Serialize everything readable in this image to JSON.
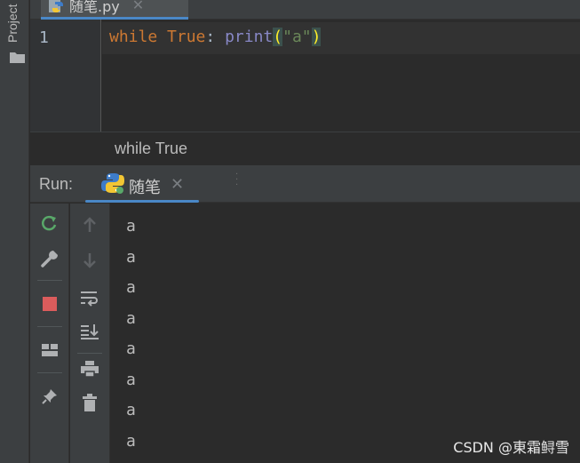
{
  "sidebar": {
    "project_label": "Project"
  },
  "editor": {
    "tab": {
      "filename": "随笔.py",
      "close": "✕"
    },
    "line_number": "1",
    "code": {
      "kw_while": "while",
      "kw_true": "True",
      "colon": ":",
      "fn_print": "print",
      "paren_open": "(",
      "string": "\"a\"",
      "paren_close": ")"
    },
    "breadcrumb": "while True"
  },
  "run": {
    "label": "Run:",
    "tab_name": "随笔",
    "tab_close": "✕",
    "output_lines": [
      "a",
      "a",
      "a",
      "a",
      "a",
      "a",
      "a",
      "a"
    ]
  },
  "colors": {
    "accent": "#4a88c7",
    "rerun": "#59a869",
    "stop": "#db5c5c",
    "keyword": "#cc7832",
    "string": "#6a8759",
    "builtin": "#8888c6"
  },
  "watermark": "CSDN @東霜鲟雪"
}
